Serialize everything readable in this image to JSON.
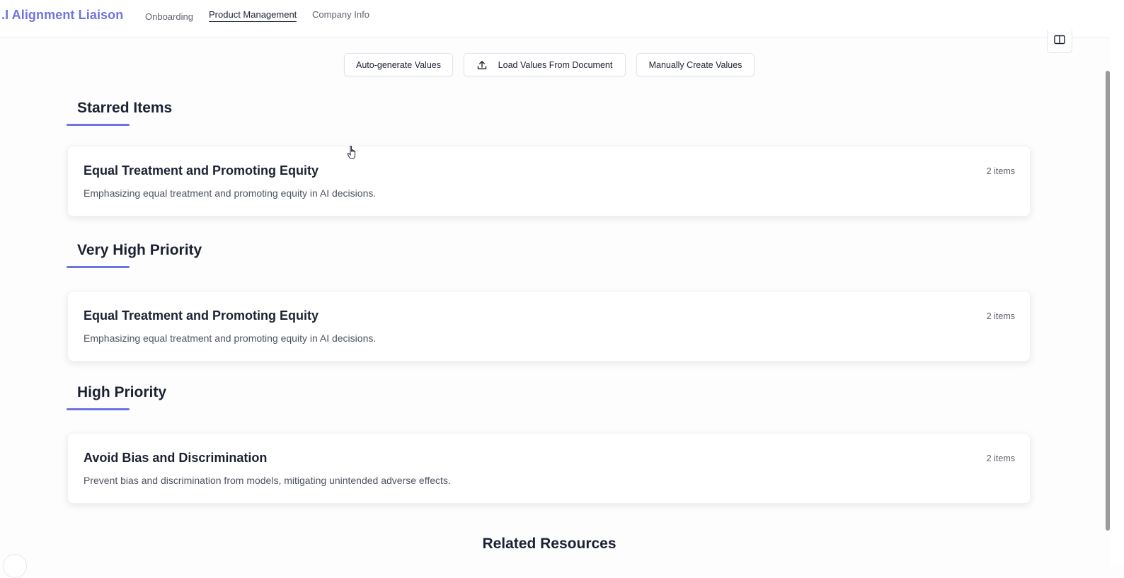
{
  "header": {
    "brand": ".I Alignment Liaison",
    "nav": [
      {
        "label": "Onboarding",
        "active": false
      },
      {
        "label": "Product Management",
        "active": true
      },
      {
        "label": "Company Info",
        "active": false
      }
    ],
    "corner_icon": "book-icon"
  },
  "actions": {
    "auto_generate": "Auto-generate Values",
    "load_from_document": "Load Values From Document",
    "load_icon": "upload-icon",
    "manual_create": "Manually Create Values"
  },
  "sections": [
    {
      "title": "Starred Items",
      "cards": [
        {
          "title": "Equal Treatment and Promoting Equity",
          "description": "Emphasizing equal treatment and promoting equity in AI decisions.",
          "count": "2 items"
        }
      ]
    },
    {
      "title": "Very High Priority",
      "cards": [
        {
          "title": "Equal Treatment and Promoting Equity",
          "description": "Emphasizing equal treatment and promoting equity in AI decisions.",
          "count": "2 items"
        }
      ]
    },
    {
      "title": "High Priority",
      "cards": [
        {
          "title": "Avoid Bias and Discrimination",
          "description": "Prevent bias and discrimination from models, mitigating unintended adverse effects.",
          "count": "2 items"
        }
      ]
    }
  ],
  "related": {
    "title": "Related Resources"
  },
  "colors": {
    "accent": "#6d73e3",
    "brand": "#6f74e0",
    "text": "#1c2233"
  }
}
